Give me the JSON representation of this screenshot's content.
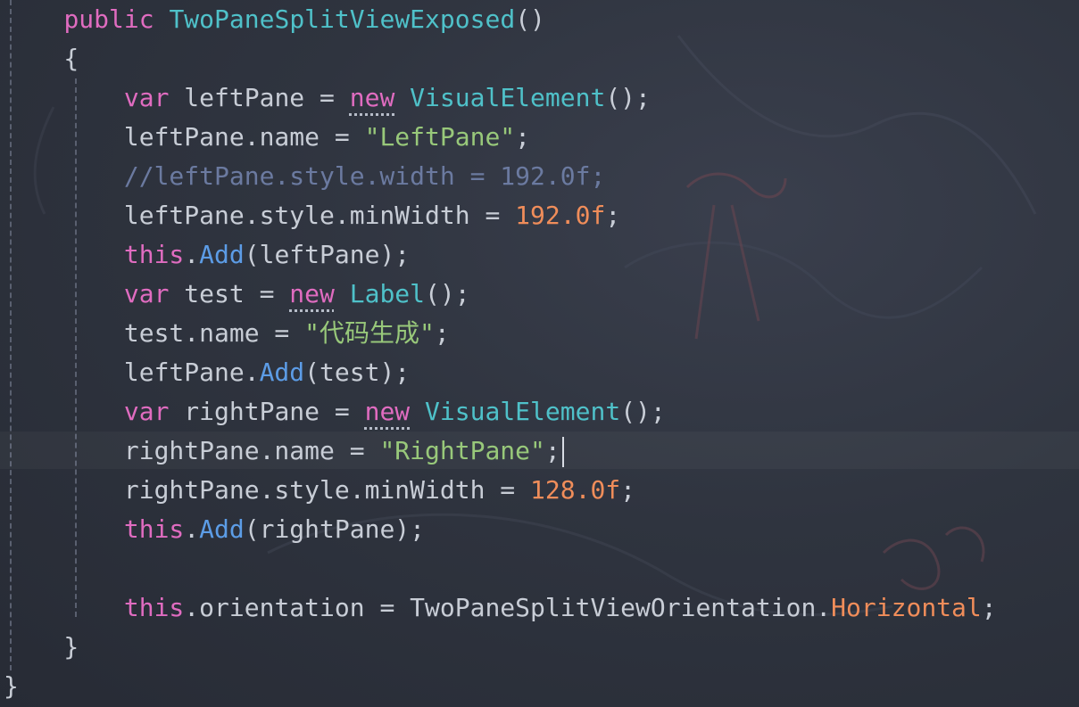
{
  "editor": {
    "lines": [
      [
        {
          "t": "    ",
          "c": "pun"
        },
        {
          "t": "public",
          "c": "kw"
        },
        {
          "t": " ",
          "c": "pun"
        },
        {
          "t": "TwoPaneSplitViewExposed",
          "c": "typ"
        },
        {
          "t": "()",
          "c": "pun"
        }
      ],
      [
        {
          "t": "    {",
          "c": "pun"
        }
      ],
      [
        {
          "t": "        ",
          "c": "pun"
        },
        {
          "t": "var",
          "c": "kw"
        },
        {
          "t": " leftPane = ",
          "c": "id"
        },
        {
          "t": "new",
          "c": "kw"
        },
        {
          "t": " ",
          "c": "pun"
        },
        {
          "t": "VisualElement",
          "c": "typ"
        },
        {
          "t": "();",
          "c": "pun"
        }
      ],
      [
        {
          "t": "        leftPane",
          "c": "id"
        },
        {
          "t": ".",
          "c": "pun"
        },
        {
          "t": "name",
          "c": "id"
        },
        {
          "t": " = ",
          "c": "pun"
        },
        {
          "t": "\"LeftPane\"",
          "c": "str"
        },
        {
          "t": ";",
          "c": "pun"
        }
      ],
      [
        {
          "t": "        //leftPane.style.width = 192.0f;",
          "c": "cmt"
        }
      ],
      [
        {
          "t": "        leftPane.style.minWidth = ",
          "c": "id"
        },
        {
          "t": "192.0f",
          "c": "num"
        },
        {
          "t": ";",
          "c": "pun"
        }
      ],
      [
        {
          "t": "        ",
          "c": "pun"
        },
        {
          "t": "this",
          "c": "kw"
        },
        {
          "t": ".",
          "c": "pun"
        },
        {
          "t": "Add",
          "c": "fn"
        },
        {
          "t": "(leftPane);",
          "c": "pun"
        }
      ],
      [
        {
          "t": "        ",
          "c": "pun"
        },
        {
          "t": "var",
          "c": "kw"
        },
        {
          "t": " test = ",
          "c": "id"
        },
        {
          "t": "new",
          "c": "kw"
        },
        {
          "t": " ",
          "c": "pun"
        },
        {
          "t": "Label",
          "c": "typ"
        },
        {
          "t": "();",
          "c": "pun"
        }
      ],
      [
        {
          "t": "        test.name = ",
          "c": "id"
        },
        {
          "t": "\"代码生成\"",
          "c": "str"
        },
        {
          "t": ";",
          "c": "pun"
        }
      ],
      [
        {
          "t": "        leftPane.",
          "c": "id"
        },
        {
          "t": "Add",
          "c": "fn"
        },
        {
          "t": "(test);",
          "c": "pun"
        }
      ],
      [
        {
          "t": "        ",
          "c": "pun"
        },
        {
          "t": "var",
          "c": "kw"
        },
        {
          "t": " rightPane = ",
          "c": "id"
        },
        {
          "t": "new",
          "c": "kw"
        },
        {
          "t": " ",
          "c": "pun"
        },
        {
          "t": "VisualElement",
          "c": "typ"
        },
        {
          "t": "();",
          "c": "pun"
        }
      ],
      [
        {
          "t": "        rightPane.name = ",
          "c": "id"
        },
        {
          "t": "\"RightPane\"",
          "c": "str"
        },
        {
          "t": ";",
          "c": "pun"
        }
      ],
      [
        {
          "t": "        rightPane.style.minWidth = ",
          "c": "id"
        },
        {
          "t": "128.0f",
          "c": "num"
        },
        {
          "t": ";",
          "c": "pun"
        }
      ],
      [
        {
          "t": "        ",
          "c": "pun"
        },
        {
          "t": "this",
          "c": "kw"
        },
        {
          "t": ".",
          "c": "pun"
        },
        {
          "t": "Add",
          "c": "fn"
        },
        {
          "t": "(rightPane);",
          "c": "pun"
        }
      ],
      [
        {
          "t": "",
          "c": "pun"
        }
      ],
      [
        {
          "t": "        ",
          "c": "pun"
        },
        {
          "t": "this",
          "c": "kw"
        },
        {
          "t": ".orientation = TwoPaneSplitViewOrientation.",
          "c": "id"
        },
        {
          "t": "Horizontal",
          "c": "enm"
        },
        {
          "t": ";",
          "c": "pun"
        }
      ],
      [
        {
          "t": "    }",
          "c": "pun"
        }
      ],
      [
        {
          "t": "}",
          "c": "pun"
        }
      ]
    ]
  },
  "colors": {
    "keyword": "#e06cc0",
    "type": "#4fc1c9",
    "method": "#5c9ce6",
    "string": "#98c87a",
    "number": "#f08d5a",
    "comment": "#6b7aa0",
    "text": "#c8cdd6"
  }
}
